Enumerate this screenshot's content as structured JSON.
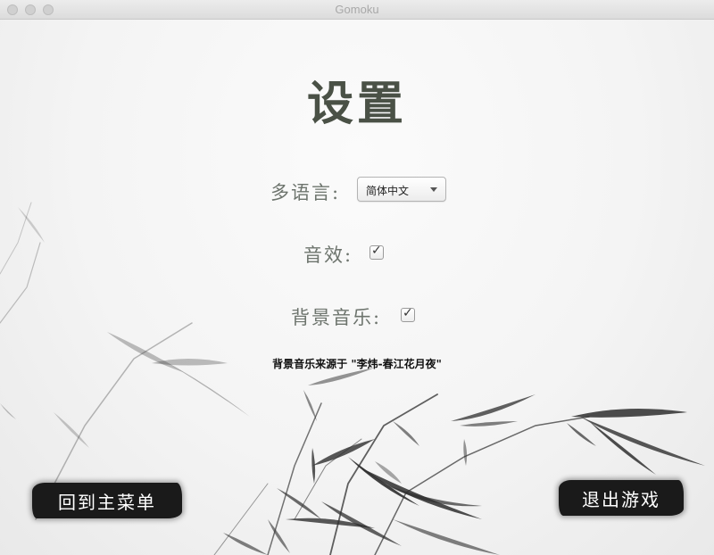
{
  "window": {
    "title": "Gomoku"
  },
  "page": {
    "title": "设置"
  },
  "settings": {
    "language_label": "多语言:",
    "language_selected": "简体中文",
    "sound_effects_label": "音效:",
    "sound_effects_checked": true,
    "background_music_label": "背景音乐:",
    "background_music_checked": true,
    "checkmark_glyph": "✓",
    "music_credit": "背景音乐来源于 \"李炜-春江花月夜\""
  },
  "buttons": {
    "back_to_menu": "回到主菜单",
    "exit_game": "退出游戏"
  },
  "colors": {
    "title_text": "#4a5146",
    "label_text": "#6d746d",
    "button_bg": "#1a1a1a",
    "button_text": "#ffffff"
  }
}
